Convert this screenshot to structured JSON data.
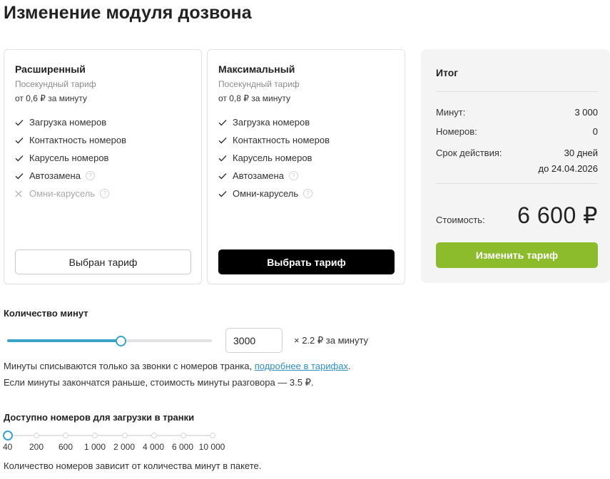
{
  "page_title": "Изменение модуля дозвона",
  "plans": [
    {
      "name": "Расширенный",
      "type": "Посекундный тариф",
      "price": "от 0,6 ₽ за минуту",
      "features": [
        {
          "label": "Загрузка номеров",
          "enabled": true,
          "help": false
        },
        {
          "label": "Контактность номеров",
          "enabled": true,
          "help": false
        },
        {
          "label": "Карусель номеров",
          "enabled": true,
          "help": false
        },
        {
          "label": "Автозамена",
          "enabled": true,
          "help": true
        },
        {
          "label": "Омни-карусель",
          "enabled": false,
          "help": true
        }
      ],
      "button_label": "Выбран тариф",
      "selected": true
    },
    {
      "name": "Максимальный",
      "type": "Посекундный тариф",
      "price": "от 0,8 ₽ за минуту",
      "features": [
        {
          "label": "Загрузка номеров",
          "enabled": true,
          "help": false
        },
        {
          "label": "Контактность номеров",
          "enabled": true,
          "help": false
        },
        {
          "label": "Карусель номеров",
          "enabled": true,
          "help": false
        },
        {
          "label": "Автозамена",
          "enabled": true,
          "help": true
        },
        {
          "label": "Омни-карусель",
          "enabled": true,
          "help": true
        }
      ],
      "button_label": "Выбрать тариф",
      "selected": false
    }
  ],
  "summary": {
    "title": "Итог",
    "minutes_label": "Минут:",
    "minutes_value": "3 000",
    "numbers_label": "Номеров:",
    "numbers_value": "0",
    "validity_label": "Срок действия:",
    "validity_days": "30 дней",
    "validity_until": "до 24.04.2026",
    "cost_label": "Стоимость:",
    "cost_value": "6 600 ₽",
    "change_button": "Изменить тариф",
    "accent_color": "#8cbc2b"
  },
  "minutes": {
    "title": "Количество минут",
    "value": "3000",
    "slider_fraction": 0.55,
    "rate": "× 2.2 ₽ за минуту",
    "note1_text": "Минуты списываются только за звонки с номеров транка, ",
    "note1_link": "подробнее в тарифах",
    "note1_tail": ".",
    "note2": "Если минуты закончатся раньше, стоимость минуты разговора — 3.5 ₽.",
    "accent_color": "#3aa3c8"
  },
  "numbers": {
    "title": "Доступно номеров для загрузки в транки",
    "ticks": [
      "40",
      "200",
      "600",
      "1 000",
      "2 000",
      "4 000",
      "6 000",
      "10 000"
    ],
    "selected_index": 0,
    "note": "Количество номеров зависит от количества минут в пакете."
  }
}
